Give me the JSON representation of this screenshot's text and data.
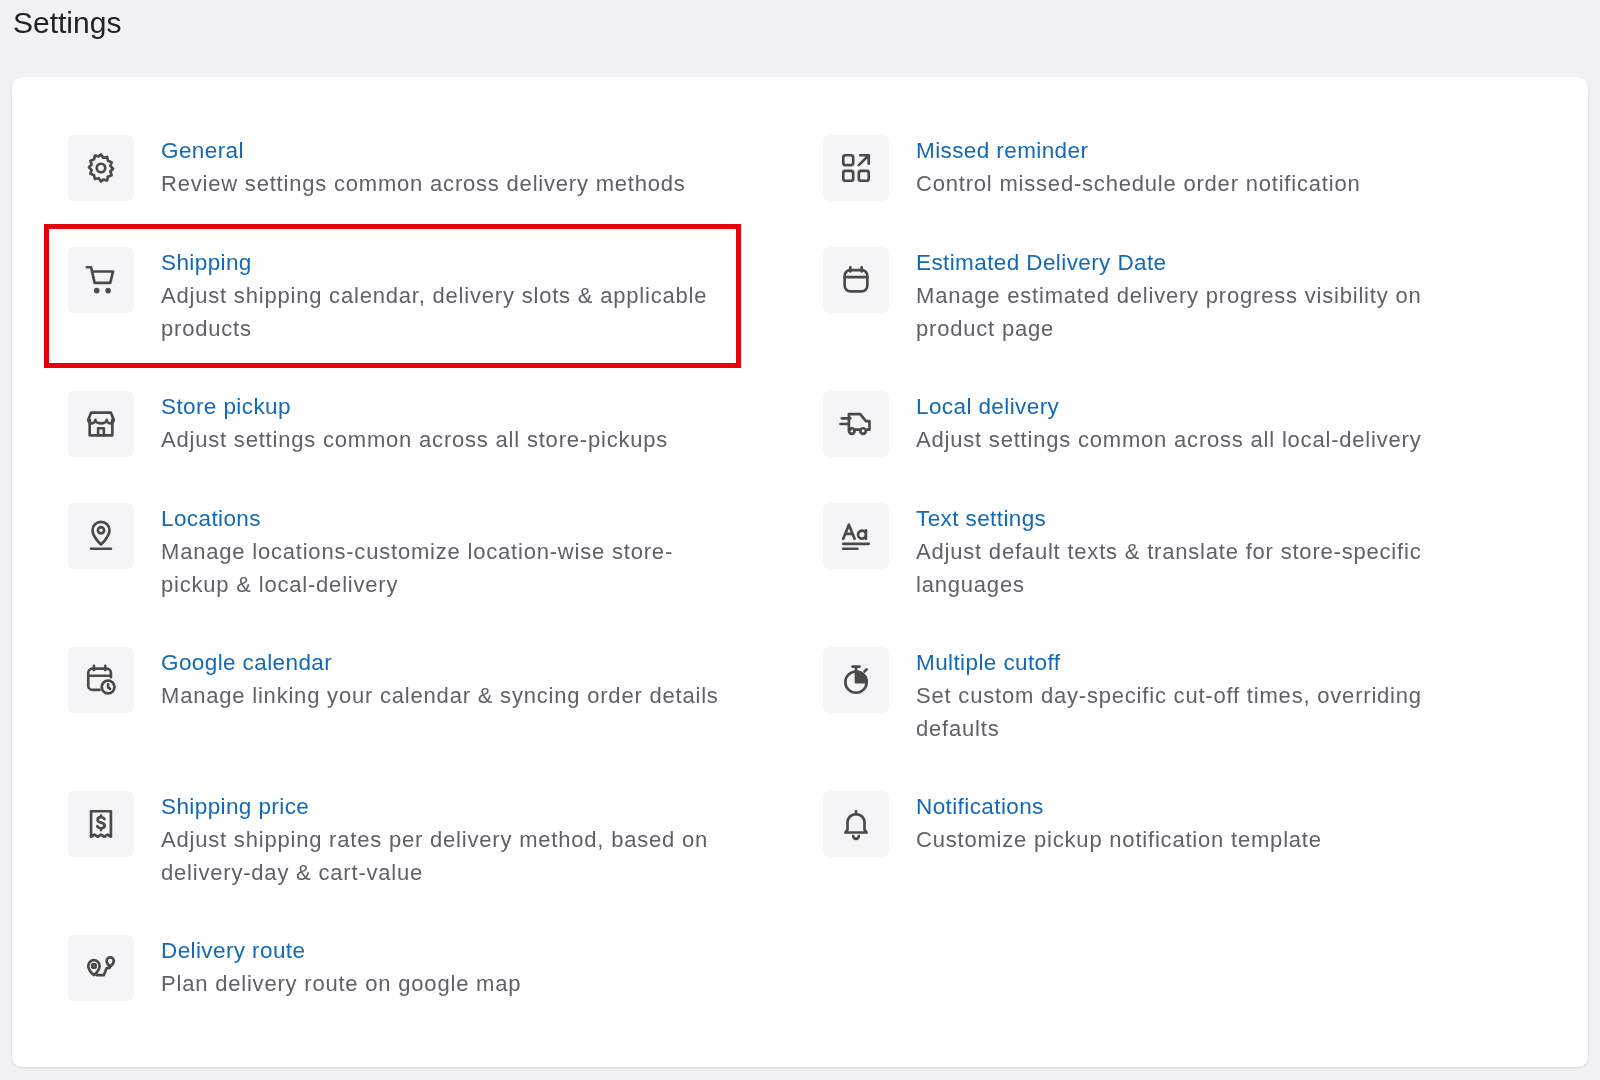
{
  "title": "Settings",
  "items": [
    {
      "kind": "gear",
      "title": "General",
      "description": "Review settings common across delivery methods",
      "highlighted": false
    },
    {
      "kind": "apps-arrow",
      "title": "Missed reminder",
      "description": "Control missed-schedule order notification",
      "highlighted": false
    },
    {
      "kind": "cart",
      "title": "Shipping",
      "description": "Adjust shipping calendar, delivery slots & applicable products",
      "highlighted": true
    },
    {
      "kind": "calendar",
      "title": "Estimated Delivery Date",
      "description": "Manage estimated delivery progress visibility on product page",
      "highlighted": false
    },
    {
      "kind": "store",
      "title": "Store pickup",
      "description": "Adjust settings common across all store-pickups",
      "highlighted": false
    },
    {
      "kind": "truck",
      "title": "Local delivery",
      "description": "Adjust settings common across all local-delivery",
      "highlighted": false
    },
    {
      "kind": "pin",
      "title": "Locations",
      "description": "Manage locations-customize location-wise store-pickup & local-delivery",
      "highlighted": false
    },
    {
      "kind": "text",
      "title": "Text settings",
      "description": "Adjust default texts & translate for store-specific languages",
      "highlighted": false
    },
    {
      "kind": "calendar-clock",
      "title": "Google calendar",
      "description": "Manage linking your calendar & syncing order details",
      "highlighted": false
    },
    {
      "kind": "stopwatch",
      "title": "Multiple cutoff",
      "description": "Set custom day-specific cut-off times, overriding defaults",
      "highlighted": false
    },
    {
      "kind": "receipt",
      "title": "Shipping price",
      "description": "Adjust shipping rates per delivery method, based on delivery-day & cart-value",
      "highlighted": false
    },
    {
      "kind": "bell",
      "title": "Notifications",
      "description": "Customize pickup notification template",
      "highlighted": false
    },
    {
      "kind": "route",
      "title": "Delivery route",
      "description": "Plan delivery route on google map",
      "highlighted": false
    }
  ]
}
